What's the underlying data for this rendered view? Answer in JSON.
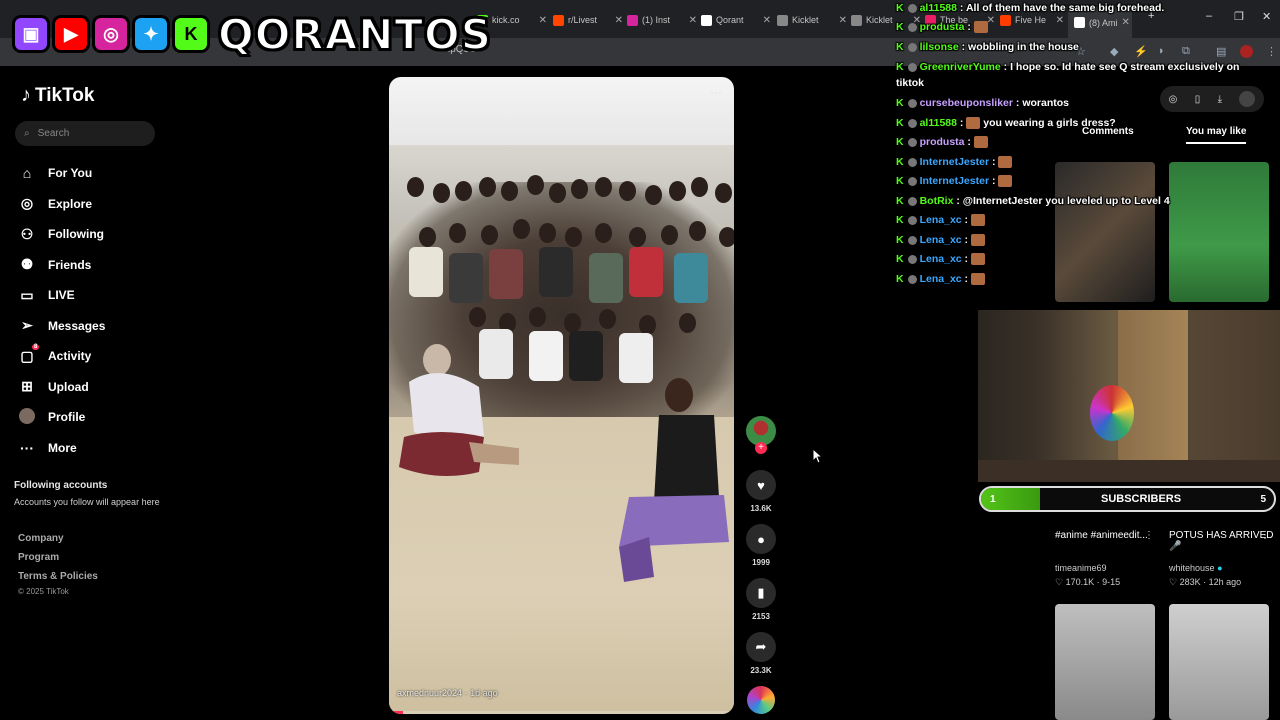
{
  "browser": {
    "tabs": [
      {
        "label": "kick.co",
        "color": "#53fc18"
      },
      {
        "label": "r/Livest",
        "color": "#ff4500"
      },
      {
        "label": "(1) Inst",
        "color": "#d6249f"
      },
      {
        "label": "Qorant",
        "color": "#ffffff"
      },
      {
        "label": "Kicklet",
        "color": "#888888"
      },
      {
        "label": "Kicklet",
        "color": "#888888"
      },
      {
        "label": "The be",
        "color": "#e91e63"
      },
      {
        "label": "Five He",
        "color": "#ff3d00"
      },
      {
        "label": "(8) Ami",
        "color": "#ffffff"
      }
    ],
    "url_fragment": "ipQ9O"
  },
  "banner": {
    "channel_name": "QORANTOS",
    "social_icons": [
      "twitch-icon",
      "youtube-icon",
      "instagram-icon",
      "twitter-icon",
      "kick-icon"
    ],
    "colors": {
      "twitch": "#9146ff",
      "youtube": "#ff0000",
      "instagram": "#d6249f",
      "twitter": "#1da1f2",
      "kick": "#53fc18"
    }
  },
  "sidebar": {
    "logo": "TikTok",
    "search_placeholder": "Search",
    "nav": [
      {
        "label": "For You",
        "icon": "home-icon",
        "glyph": "⌂"
      },
      {
        "label": "Explore",
        "icon": "compass-icon",
        "glyph": "◎"
      },
      {
        "label": "Following",
        "icon": "person-icon",
        "glyph": "⚇"
      },
      {
        "label": "Friends",
        "icon": "friends-icon",
        "glyph": "⚉"
      },
      {
        "label": "LIVE",
        "icon": "live-icon",
        "glyph": "▭"
      },
      {
        "label": "Messages",
        "icon": "paper-plane-icon",
        "glyph": "➢"
      },
      {
        "label": "Activity",
        "icon": "activity-icon",
        "glyph": "▢",
        "badge": "8"
      },
      {
        "label": "Upload",
        "icon": "plus-square-icon",
        "glyph": "⊞"
      },
      {
        "label": "Profile",
        "icon": "avatar-icon",
        "glyph": ""
      },
      {
        "label": "More",
        "icon": "more-icon",
        "glyph": "···"
      }
    ],
    "following_heading": "Following accounts",
    "following_sub": "Accounts you follow will appear here",
    "footer_links": [
      "Company",
      "Program",
      "Terms & Policies"
    ],
    "copyright": "© 2025 TikTok"
  },
  "video": {
    "author": "axmednuur2024",
    "age": "1d ago",
    "progress": 0.04,
    "likes": "13.6K",
    "comments": "1999",
    "saves": "2153",
    "shares": "23.3K"
  },
  "chat": [
    {
      "user": "al11588",
      "color": "#53fc18",
      "msg": "All of them have the same big forehead."
    },
    {
      "user": "produsta",
      "color": "#53fc18",
      "msg": "",
      "emote": true
    },
    {
      "user": "lilsonse",
      "color": "#53fc18",
      "msg": "wobbling in the house"
    },
    {
      "user": "GreenriverYume",
      "color": "#53fc18",
      "msg": "I hope so. Id hate see Q stream exclusively on"
    },
    {
      "user": "",
      "color": "#ffffff",
      "msg": "tiktok"
    },
    {
      "user": "cursebeuponsliker",
      "color": "#c8a0ff",
      "msg": "worantos"
    },
    {
      "user": "al11588",
      "color": "#53fc18",
      "msg": "you wearing a girls dress?",
      "emote": true
    },
    {
      "user": "produsta",
      "color": "#c8a0ff",
      "msg": "",
      "emote": true
    },
    {
      "user": "InternetJester",
      "color": "#3aa7ff",
      "msg": "",
      "emote": true
    },
    {
      "user": "InternetJester",
      "color": "#3aa7ff",
      "msg": "",
      "emote": true
    },
    {
      "user": "BotRix",
      "color": "#53fc18",
      "msg": "@InternetJester you leveled up to Level 4"
    },
    {
      "user": "Lena_xc",
      "color": "#3aa7ff",
      "msg": "",
      "emote": true
    },
    {
      "user": "Lena_xc",
      "color": "#3aa7ff",
      "msg": "",
      "emote": true
    },
    {
      "user": "Lena_xc",
      "color": "#3aa7ff",
      "msg": "",
      "emote": true
    },
    {
      "user": "Lena_xc",
      "color": "#3aa7ff",
      "msg": "",
      "emote": true
    }
  ],
  "right_panel": {
    "tabs": [
      "Comments",
      "You may like"
    ],
    "active_tab": "You may like",
    "recs": [
      {
        "caption": "#anime #animeedit...",
        "author": "timeanime69",
        "stats": "170.1K · 9-15",
        "verified": false
      },
      {
        "caption": "POTUS HAS ARRIVED 🎤",
        "author": "whitehouse",
        "stats": "283K · 12h ago",
        "verified": true
      }
    ]
  },
  "subscribers": {
    "label": "SUBSCRIBERS",
    "current": "1",
    "goal": "5",
    "fraction": 0.2
  }
}
